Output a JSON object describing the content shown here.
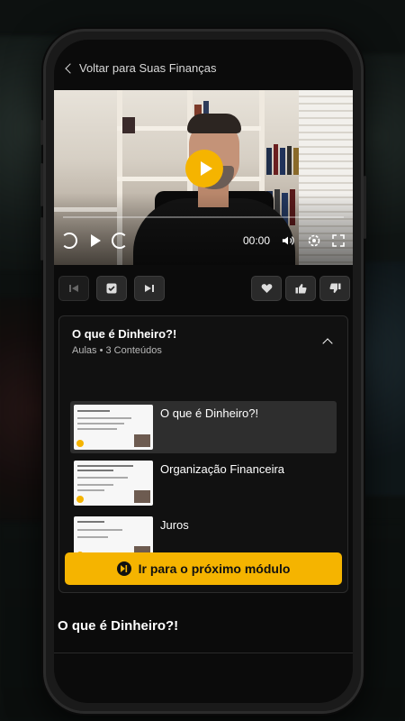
{
  "header": {
    "back_label": "Voltar para Suas Finanças"
  },
  "player": {
    "time": "00:00"
  },
  "module": {
    "title": "O que é Dinheiro?!",
    "subtitle": "Aulas • 3 Conteúdos",
    "lessons": [
      {
        "label": "O que é Dinheiro?!",
        "active": true
      },
      {
        "label": "Organização Financeira",
        "active": false
      },
      {
        "label": "Juros",
        "active": false
      }
    ],
    "next_button": "Ir para o próximo módulo"
  },
  "lesson_title": "O que é Dinheiro?!",
  "colors": {
    "accent": "#f5b400",
    "background": "#0b0b0b",
    "card": "#111111"
  }
}
